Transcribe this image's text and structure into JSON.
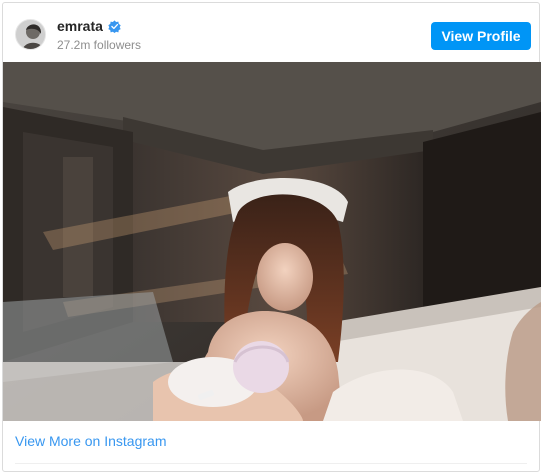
{
  "header": {
    "username": "emrata",
    "verified": true,
    "followers": "27.2m followers",
    "view_profile_label": "View Profile"
  },
  "post": {
    "image_icon": "photo"
  },
  "footer": {
    "view_more_label": "View More on Instagram"
  },
  "colors": {
    "accent": "#0095f6",
    "link": "#3897f0",
    "username": "#262626",
    "muted": "#8e8e8e"
  }
}
